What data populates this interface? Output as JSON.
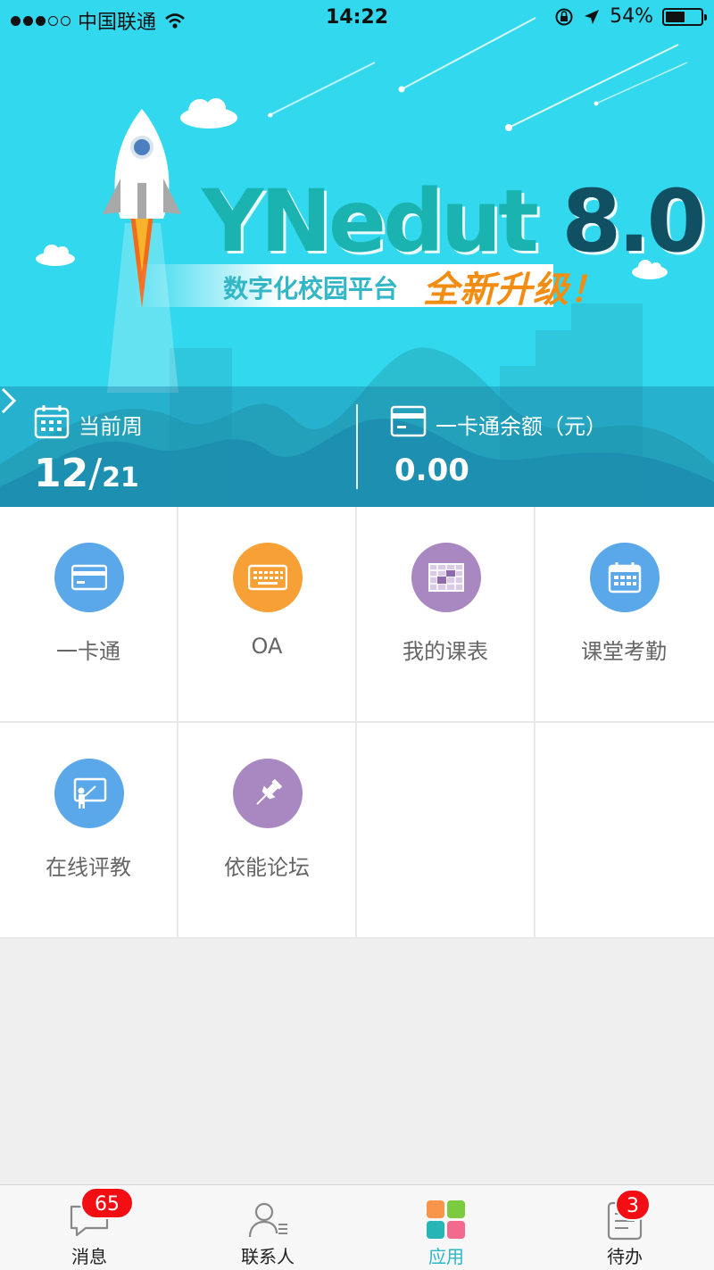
{
  "status_bar": {
    "carrier": "中国联通",
    "time": "14:22",
    "battery": "54%",
    "battery_level": 0.54
  },
  "banner": {
    "title_text": "YNedut ",
    "title_version": "8.0",
    "subtitle": "数字化校园平台",
    "subtitle_highlight": "全新升级！",
    "current_week_label": "当前周",
    "current_week": "12",
    "week_separator": "/",
    "total_weeks": "21",
    "card_balance_label": "一卡通余额（元）",
    "card_balance": "0.00"
  },
  "apps": [
    {
      "label": "一卡通",
      "icon": "card-icon",
      "color": "#5aa8ea"
    },
    {
      "label": "OA",
      "icon": "keyboard-icon",
      "color": "#f7a035"
    },
    {
      "label": "我的课表",
      "icon": "schedule-icon",
      "color": "#a988c2"
    },
    {
      "label": "课堂考勤",
      "icon": "calendar-icon",
      "color": "#5aa8ea"
    },
    {
      "label": "在线评教",
      "icon": "teacher-icon",
      "color": "#5aa8ea"
    },
    {
      "label": "依能论坛",
      "icon": "pushpin-icon",
      "color": "#a988c2"
    }
  ],
  "tabbar": {
    "items": [
      {
        "label": "消息",
        "icon": "message-icon",
        "badge": "65"
      },
      {
        "label": "联系人",
        "icon": "contacts-icon"
      },
      {
        "label": "应用",
        "icon": "apps-icon",
        "active": true
      },
      {
        "label": "待办",
        "icon": "todo-icon",
        "badge": "3"
      }
    ],
    "active_color": "#2ab7c9",
    "badge_color": "#f20e13"
  }
}
